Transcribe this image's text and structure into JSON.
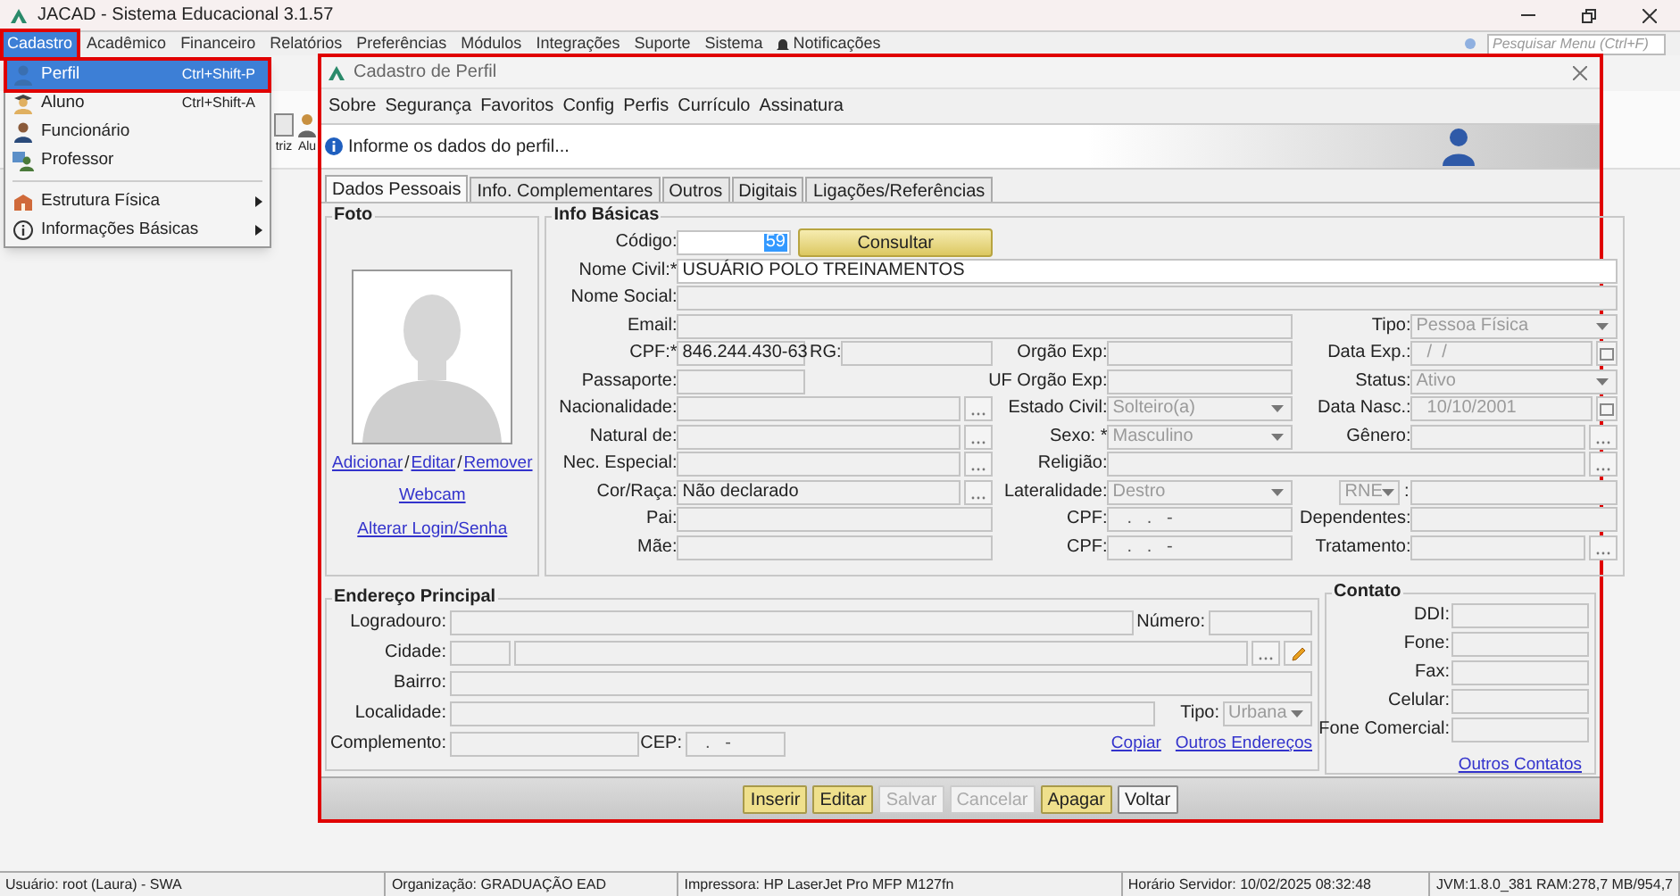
{
  "window": {
    "title": "JACAD - Sistema Educacional 3.1.57"
  },
  "menu": [
    {
      "label": "Cadastro",
      "selected": true
    },
    {
      "label": "Acadêmico",
      "selected": false
    },
    {
      "label": "Financeiro",
      "selected": false
    },
    {
      "label": "Relatórios",
      "selected": false
    },
    {
      "label": "Preferências",
      "selected": false
    },
    {
      "label": "Módulos",
      "selected": false
    },
    {
      "label": "Integrações",
      "selected": false
    },
    {
      "label": "Suporte",
      "selected": false
    },
    {
      "label": "Sistema",
      "selected": false
    },
    {
      "label": "Notificações",
      "selected": false
    }
  ],
  "search": {
    "placeholder": "Pesquisar Menu (Ctrl+F)"
  },
  "toolbar_labels": [
    "triz",
    "Alu"
  ],
  "dropdown": [
    {
      "label": "Perfil",
      "shortcut": "Ctrl+Shift-P",
      "selected": true,
      "submenu": false
    },
    {
      "label": "Aluno",
      "shortcut": "Ctrl+Shift-A",
      "selected": false,
      "submenu": false
    },
    {
      "label": "Funcionário",
      "selected": false,
      "submenu": false
    },
    {
      "label": "Professor",
      "selected": false,
      "submenu": false
    },
    {
      "label": "Estrutura Física",
      "selected": false,
      "submenu": true
    },
    {
      "label": "Informações Básicas",
      "selected": false,
      "submenu": true
    }
  ],
  "dialog": {
    "title": "Cadastro de Perfil",
    "menu": [
      "Sobre",
      "Segurança",
      "Favoritos",
      "Config",
      "Perfis",
      "Currículo",
      "Assinatura"
    ],
    "banner": "Informe os dados do perfil...",
    "tabs": [
      {
        "label": "Dados Pessoais",
        "selected": true
      },
      {
        "label": "Info. Complementares",
        "selected": false
      },
      {
        "label": "Outros",
        "selected": false
      },
      {
        "label": "Digitais",
        "selected": false
      },
      {
        "label": "Ligações/Referências",
        "selected": false
      }
    ],
    "foto": {
      "title": "Foto",
      "links": [
        "Adicionar",
        "Editar",
        "Remover"
      ],
      "separator": "/",
      "webcam": "Webcam",
      "login": "Alterar Login/Senha"
    },
    "info": {
      "title": "Info Básicas",
      "codigo": {
        "label": "Código:",
        "value": "59",
        "highlighted": true
      },
      "consultar": "Consultar",
      "fields": [
        {
          "label": "Nome Civil:*",
          "kind": "text",
          "value": "USUÁRIO POLO TREINAMENTOS",
          "disabled": false
        },
        {
          "label": "Nome Social:",
          "kind": "text",
          "disabled": true
        },
        {
          "label": "Email:",
          "kind": "text",
          "disabled": true
        },
        {
          "label": "Tipo:",
          "kind": "combo",
          "value": "Pessoa Física",
          "disabled": true
        },
        {
          "label": "CPF:*",
          "kind": "text",
          "value": "846.244.430-63",
          "disabled": true
        },
        {
          "label": "RG:",
          "kind": "text",
          "disabled": true
        },
        {
          "label": "Orgão Exp:",
          "kind": "text",
          "disabled": true
        },
        {
          "label": "Data Exp.:",
          "kind": "date",
          "value": "/  /",
          "disabled": true
        },
        {
          "label": "Passaporte:",
          "kind": "text",
          "disabled": true
        },
        {
          "label": "UF Orgão Exp:",
          "kind": "text",
          "disabled": true
        },
        {
          "label": "Status:",
          "kind": "combo",
          "value": "Ativo",
          "disabled": true
        },
        {
          "label": "Nacionalidade:",
          "kind": "lookup",
          "disabled": true
        },
        {
          "label": "Estado Civil:",
          "kind": "combo",
          "value": "Solteiro(a)",
          "disabled": true
        },
        {
          "label": "Data Nasc.:",
          "kind": "date",
          "value": "10/10/2001",
          "disabled": true
        },
        {
          "label": "Natural de:",
          "kind": "lookup",
          "disabled": true
        },
        {
          "label": "Sexo: *",
          "kind": "combo",
          "value": "Masculino",
          "disabled": true
        },
        {
          "label": "Gênero:",
          "kind": "lookup",
          "disabled": true
        },
        {
          "label": "Nec. Especial:",
          "kind": "lookup",
          "disabled": true
        },
        {
          "label": "Religião:",
          "kind": "lookup",
          "disabled": true
        },
        {
          "label": "Cor/Raça:",
          "kind": "lookup",
          "value": "Não declarado",
          "disabled": true
        },
        {
          "label": "Lateralidade:",
          "kind": "combo",
          "value": "Destro",
          "disabled": true
        },
        {
          "kind": "combo",
          "value": "RNE",
          "disabled": true
        },
        {
          "label": ":",
          "kind": "text",
          "disabled": true
        },
        {
          "label": "Pai:",
          "kind": "text",
          "disabled": true
        },
        {
          "label": "CPF:",
          "kind": "mask",
          "value": ".   .   -",
          "disabled": true
        },
        {
          "label": "Dependentes:",
          "kind": "text",
          "disabled": true
        },
        {
          "label": "Mãe:",
          "kind": "text",
          "disabled": true
        },
        {
          "label": "CPF:",
          "kind": "mask",
          "value": ".   .   -",
          "disabled": true
        },
        {
          "label": "Tratamento:",
          "kind": "lookup",
          "disabled": true
        }
      ]
    },
    "endereco": {
      "title": "Endereço Principal",
      "fields": [
        {
          "label": "Logradouro:",
          "kind": "text",
          "disabled": true
        },
        {
          "label": "Número:",
          "kind": "text",
          "disabled": true
        },
        {
          "label": "Cidade:",
          "kind": "city",
          "disabled": true
        },
        {
          "label": "Bairro:",
          "kind": "text",
          "disabled": true
        },
        {
          "label": "Localidade:",
          "kind": "text",
          "disabled": true
        },
        {
          "label": "Tipo:",
          "kind": "combo",
          "value": "Urbana",
          "disabled": true
        },
        {
          "label": "Complemento:",
          "kind": "text",
          "disabled": true
        },
        {
          "label": "CEP:",
          "kind": "mask",
          "value": ".   -",
          "disabled": true
        }
      ],
      "links": [
        "Copiar",
        "Outros Endereços"
      ]
    },
    "contato": {
      "title": "Contato",
      "fields": [
        "DDI:",
        "Fone:",
        "Fax:",
        "Celular:",
        "Fone Comercial:"
      ],
      "link": "Outros Contatos"
    },
    "buttons": [
      {
        "label": "Inserir",
        "kind": "highlight",
        "disabled": false
      },
      {
        "label": "Editar",
        "kind": "highlight",
        "disabled": false
      },
      {
        "label": "Salvar",
        "kind": "plain",
        "disabled": true
      },
      {
        "label": "Cancelar",
        "kind": "plain",
        "disabled": true
      },
      {
        "label": "Apagar",
        "kind": "highlight",
        "disabled": false
      },
      {
        "label": "Voltar",
        "kind": "plain",
        "disabled": false
      }
    ]
  },
  "status_bar": [
    "Usuário: root (Laura) - SWA",
    "Organização: GRADUAÇÃO EAD",
    "Impressora: HP LaserJet Pro MFP M127fn",
    "Horário Servidor: 10/02/2025 08:32:48",
    "JVM:1.8.0_381  RAM:278,7 MB/954,7"
  ]
}
